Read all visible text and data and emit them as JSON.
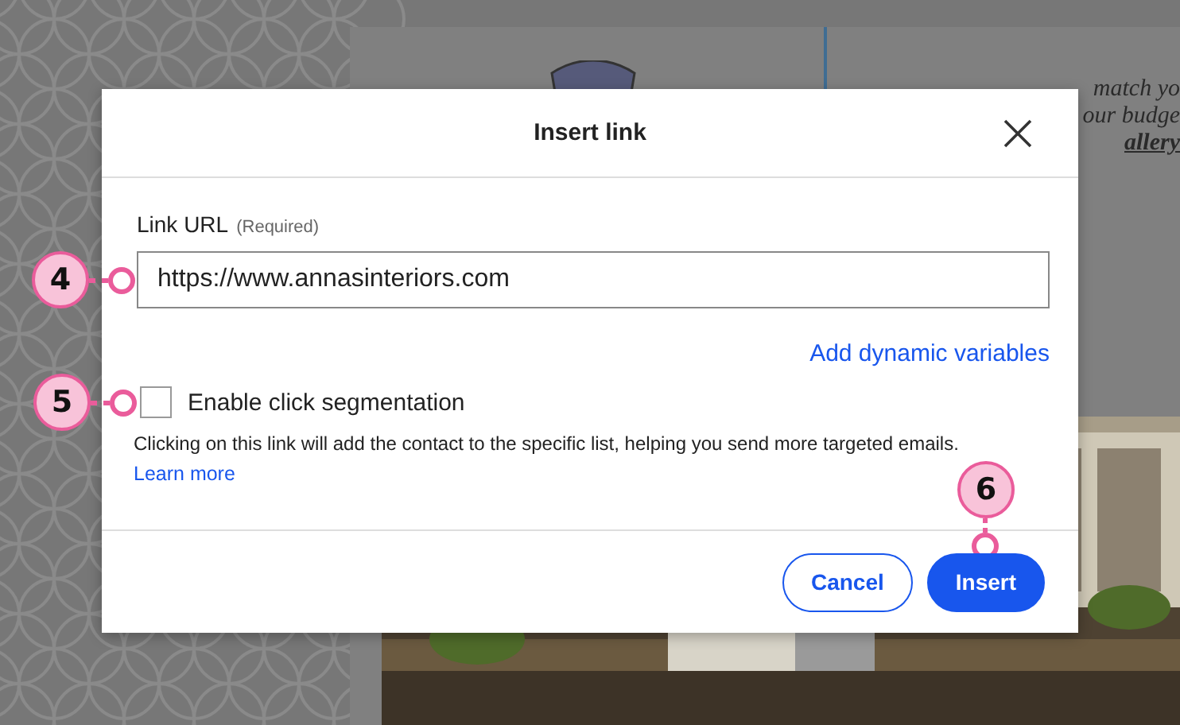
{
  "background": {
    "text_fragments": [
      "match yo",
      "our budge"
    ],
    "link_fragment": "allery"
  },
  "dialog": {
    "title": "Insert link",
    "field": {
      "label": "Link URL",
      "hint": "(Required)",
      "value": "https://www.annasinteriors.com",
      "callout": "4"
    },
    "variables_link": "Add dynamic variables",
    "checkbox": {
      "label": "Enable click segmentation",
      "checked": false,
      "callout": "5"
    },
    "description": "Clicking on this link will add the contact to the specific list, helping you send more targeted emails.",
    "learn_more": "Learn more",
    "buttons": [
      {
        "label": "Cancel",
        "kind": "secondary"
      },
      {
        "label": "Insert",
        "kind": "primary",
        "callout": "6"
      }
    ]
  }
}
